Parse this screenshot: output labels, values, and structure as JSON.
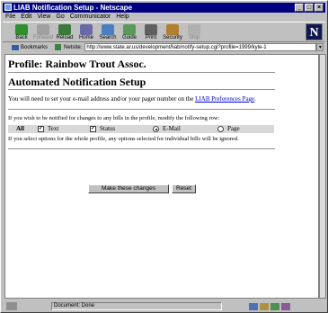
{
  "window": {
    "title": "LIAB Notification Setup - Netscape",
    "controls": [
      "_",
      "□",
      "×"
    ]
  },
  "menu": [
    "File",
    "Edit",
    "View",
    "Go",
    "Communicator",
    "Help"
  ],
  "toolbar": {
    "buttons": [
      {
        "label": "Back",
        "icon": "back-arrow-icon",
        "color": "#2f8f2f"
      },
      {
        "label": "Forward",
        "icon": "forward-arrow-icon",
        "color": "#a0a0a0",
        "disabled": true
      },
      {
        "label": "Reload",
        "icon": "reload-icon",
        "color": "#3a7a3a"
      },
      {
        "label": "Home",
        "icon": "home-icon",
        "color": "#6a6aa8"
      },
      {
        "label": "Search",
        "icon": "search-icon",
        "color": "#4a80c0"
      },
      {
        "label": "Guide",
        "icon": "guide-icon",
        "color": "#5a9a5a"
      },
      {
        "label": "Print",
        "icon": "print-icon",
        "color": "#606060"
      },
      {
        "label": "Security",
        "icon": "security-lock-icon",
        "color": "#b08030"
      },
      {
        "label": "Stop",
        "icon": "stop-icon",
        "color": "#b0b0b0",
        "disabled": true
      }
    ],
    "logo": "N"
  },
  "location": {
    "bookmarks_label": "Bookmarks",
    "netsite_label": "Netsite:",
    "url": "http://www.state.ar.us/development/liab/notify-setup.cgi?profile=1999/kyle-1"
  },
  "page": {
    "profile_heading": "Profile: Rainbow Trout Assoc.",
    "setup_heading": "Automated Notification Setup",
    "intro_text": "You will need to set your e-mail address and/or your pager number on the ",
    "intro_link": "LIAB Preferences Page",
    "intro_end": ".",
    "modify_text": "If you wish to be notified for changes to any bills in the profile, modify the following row:",
    "options": {
      "all_label": "All",
      "text_label": "Text",
      "text_checked": true,
      "status_label": "Status",
      "status_checked": true,
      "email_label": "E-Mail",
      "email_selected": true,
      "pager_label": "Page",
      "pager_selected": false
    },
    "ignore_text": "If you select options for the whole profile, any options selected for individual bills will be ignored.",
    "submit_label": "Make these changes",
    "reset_label": "Reset"
  },
  "status": {
    "text": "Document: Done"
  }
}
